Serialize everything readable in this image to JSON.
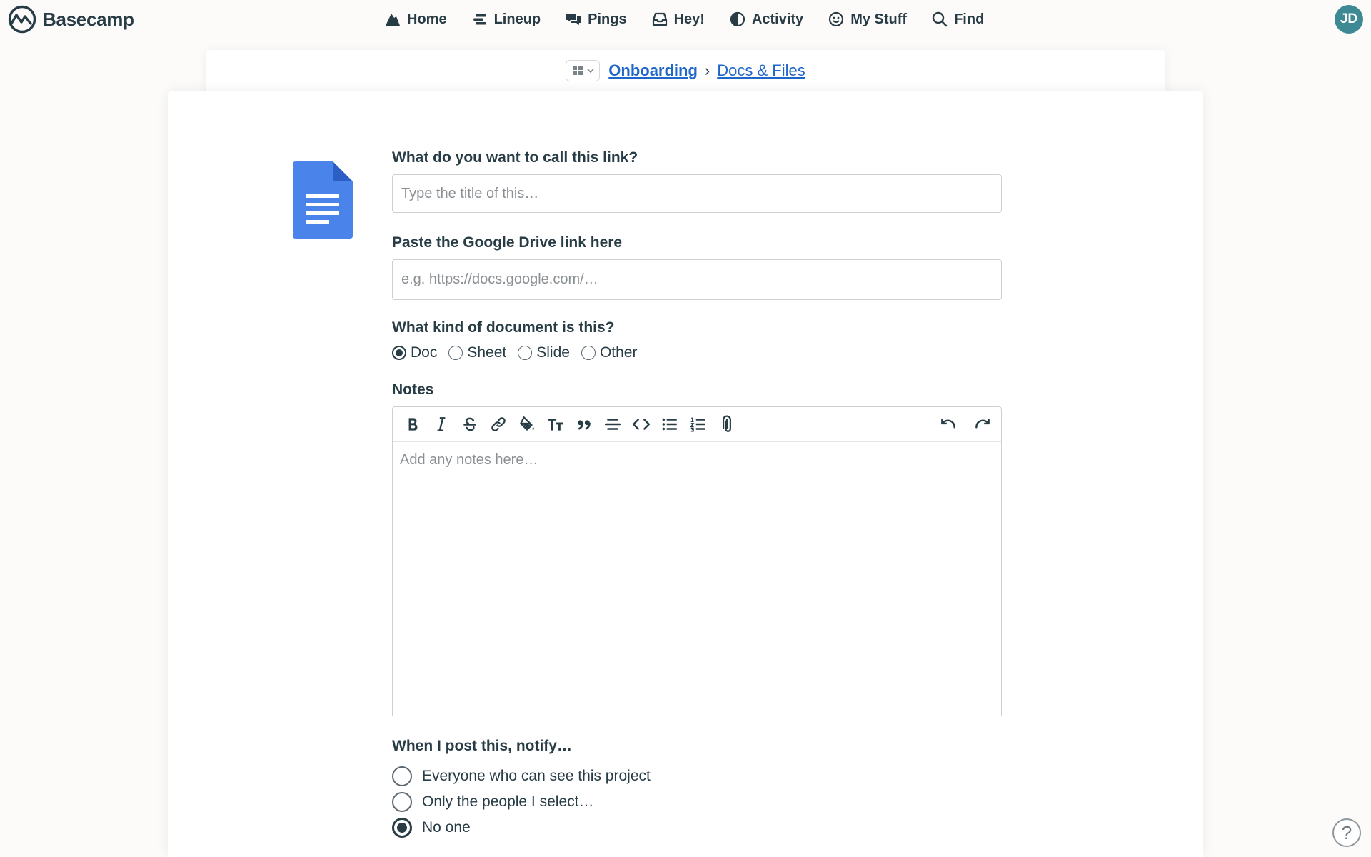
{
  "app": {
    "name": "Basecamp",
    "avatar_initials": "JD"
  },
  "nav": [
    {
      "label": "Home",
      "icon": "home-icon"
    },
    {
      "label": "Lineup",
      "icon": "lineup-icon"
    },
    {
      "label": "Pings",
      "icon": "pings-icon"
    },
    {
      "label": "Hey!",
      "icon": "inbox-icon"
    },
    {
      "label": "Activity",
      "icon": "activity-icon"
    },
    {
      "label": "My Stuff",
      "icon": "smiley-icon"
    },
    {
      "label": "Find",
      "icon": "search-icon"
    }
  ],
  "breadcrumb": {
    "project": "Onboarding",
    "separator": "›",
    "section": "Docs & Files"
  },
  "form": {
    "title_label": "What do you want to call this link?",
    "title_placeholder": "Type the title of this…",
    "link_label": "Paste the Google Drive link here",
    "link_placeholder": "e.g. https://docs.google.com/…",
    "kind_label": "What kind of document is this?",
    "kinds": [
      {
        "label": "Doc",
        "selected": true
      },
      {
        "label": "Sheet",
        "selected": false
      },
      {
        "label": "Slide",
        "selected": false
      },
      {
        "label": "Other",
        "selected": false
      }
    ],
    "notes_label": "Notes",
    "notes_placeholder": "Add any notes here…",
    "notify_label": "When I post this, notify…",
    "notify_options": [
      {
        "label": "Everyone who can see this project",
        "selected": false
      },
      {
        "label": "Only the people I select…",
        "selected": false
      },
      {
        "label": "No one",
        "selected": true
      }
    ]
  },
  "toolbar": [
    "bold-icon",
    "italic-icon",
    "strikethrough-icon",
    "link-icon",
    "highlight-icon",
    "text-size-icon",
    "quote-icon",
    "divider-icon",
    "code-icon",
    "bullet-list-icon",
    "numbered-list-icon",
    "attachment-icon"
  ],
  "help": {
    "label": "?"
  },
  "colors": {
    "accent_link": "#1f66c9",
    "text": "#283c46",
    "doc_blue": "#4a84ea",
    "avatar": "#3e8a94"
  }
}
